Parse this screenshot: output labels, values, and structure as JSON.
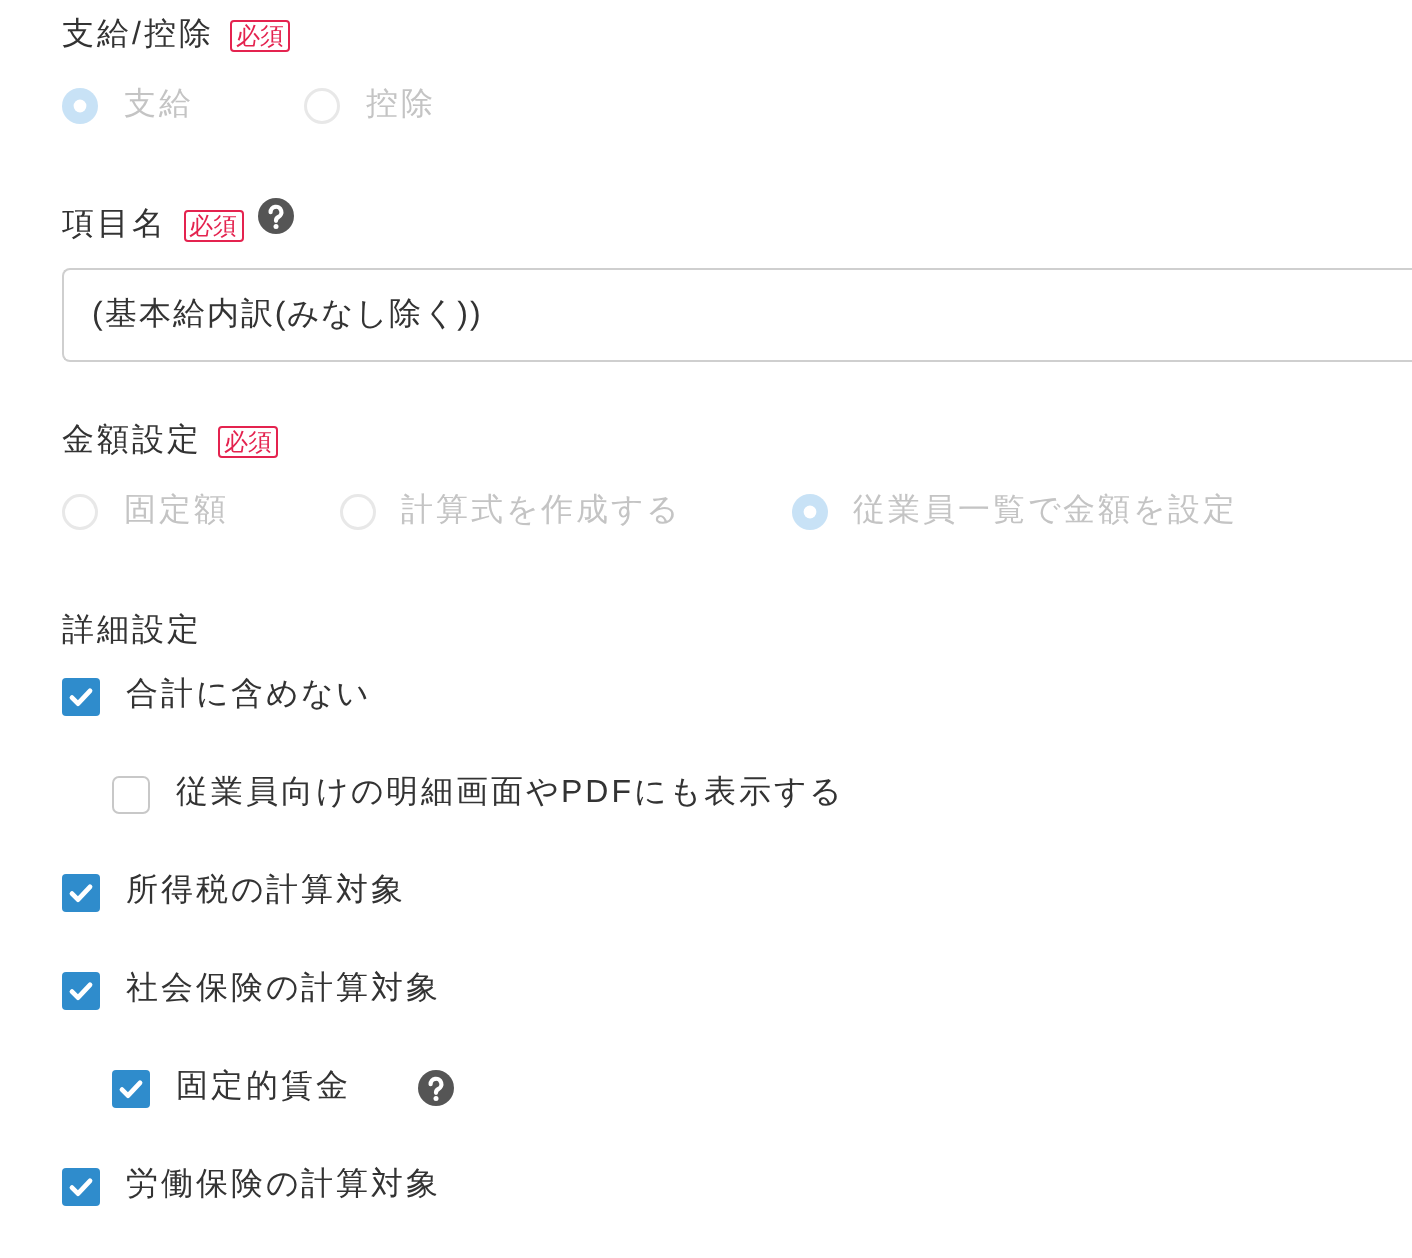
{
  "fields": [
    {
      "kind": "radio",
      "label": "支給/控除",
      "required": "必須",
      "help": false,
      "disabled": true,
      "options": [
        {
          "label": "支給",
          "selected": true
        },
        {
          "label": "控除",
          "selected": false
        }
      ]
    },
    {
      "kind": "text",
      "label": "項目名",
      "required": "必須",
      "help": true,
      "value": "(基本給内訳(みなし除く))"
    },
    {
      "kind": "radio",
      "label": "金額設定",
      "required": "必須",
      "help": false,
      "disabled": true,
      "options": [
        {
          "label": "固定額",
          "selected": false
        },
        {
          "label": "計算式を作成する",
          "selected": false
        },
        {
          "label": "従業員一覧で金額を設定",
          "selected": true
        }
      ]
    },
    {
      "kind": "checklist",
      "label": "詳細設定",
      "help": false,
      "items": [
        {
          "label": "合計に含めない",
          "checked": true,
          "help": false,
          "children": [
            {
              "label": "従業員向けの明細画面やPDFにも表示する",
              "checked": false,
              "help": false
            }
          ]
        },
        {
          "label": "所得税の計算対象",
          "checked": true,
          "help": false
        },
        {
          "label": "社会保険の計算対象",
          "checked": true,
          "help": false,
          "children": [
            {
              "label": "固定的賃金",
              "checked": true,
              "help": true
            }
          ]
        },
        {
          "label": "労働保険の計算対象",
          "checked": true,
          "help": false
        }
      ]
    }
  ]
}
